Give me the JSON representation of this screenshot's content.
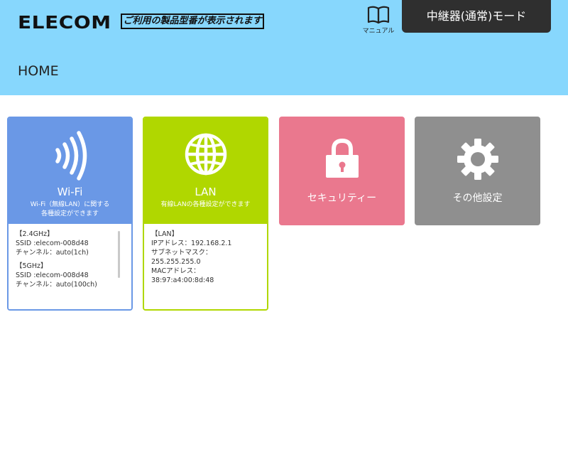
{
  "header": {
    "logo": "ELECOM",
    "model_placeholder": "ご利用の製品型番が表示されます",
    "manual_label": "マニュアル",
    "mode_label": "中継器(通常)モード",
    "page_title": "HOME"
  },
  "colors": {
    "header_bg": "#87d7fd",
    "wifi": "#6a98e6",
    "lan": "#b0d700",
    "security": "#ea788e",
    "other": "#8f8f8f",
    "mode_bg": "#2f2f2f"
  },
  "cards": {
    "wifi": {
      "icon": "wifi-signal-icon",
      "title": "Wi-Fi",
      "desc_line1": "Wi-Fi（無線LAN）に関する",
      "desc_line2": "各種設定ができます",
      "groups": [
        {
          "head": "【2.4GHz】",
          "ssid": "SSID :elecom-008d48",
          "channel": "チャンネル：auto(1ch)"
        },
        {
          "head": "【5GHz】",
          "ssid": "SSID :elecom-008d48",
          "channel": "チャンネル：auto(100ch)"
        }
      ]
    },
    "lan": {
      "icon": "globe-icon",
      "title": "LAN",
      "desc": "有線LANの各種設定ができます",
      "head": "【LAN】",
      "ip": "IPアドレス：192.168.2.1",
      "subnet_label": "サブネットマスク：",
      "subnet": "255.255.255.0",
      "mac_label": "MACアドレス：",
      "mac": "38:97:a4:00:8d:48"
    },
    "security": {
      "icon": "padlock-icon",
      "title": "セキュリティー"
    },
    "other": {
      "icon": "gear-icon",
      "title": "その他設定"
    }
  }
}
